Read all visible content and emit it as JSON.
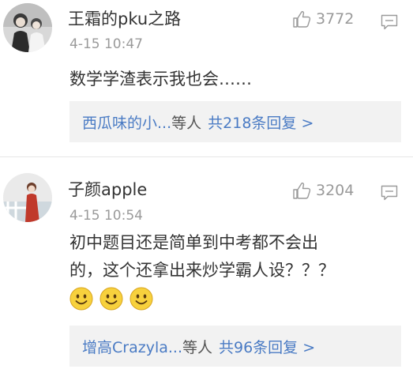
{
  "comments": [
    {
      "username": "王霜的pku之路",
      "timestamp": "4-15 10:47",
      "like_count": "3772",
      "body_lines": [
        "数学学渣表示我也会……"
      ],
      "replies": {
        "users": "西瓜味的小...",
        "suffix": "等人",
        "count_text": "共218条回复 >"
      }
    },
    {
      "username": "子颜apple",
      "timestamp": "4-15 10:54",
      "like_count": "3204",
      "body_lines": [
        "初中题目还是简单到中考都不会出",
        "的，这个还拿出来炒学霸人设？？？"
      ],
      "emoji_count": 3,
      "replies": {
        "users": "增高Crazyla...",
        "suffix": "等人",
        "count_text": "共96条回复 >"
      }
    }
  ],
  "icons": {
    "like": "thumbs-up-icon",
    "reply": "comment-icon",
    "emoji": "smiley-emoji"
  },
  "colors": {
    "link_blue": "#4a7bc4",
    "meta_grey": "#9a9a9a",
    "reply_bg": "#f2f2f2"
  }
}
